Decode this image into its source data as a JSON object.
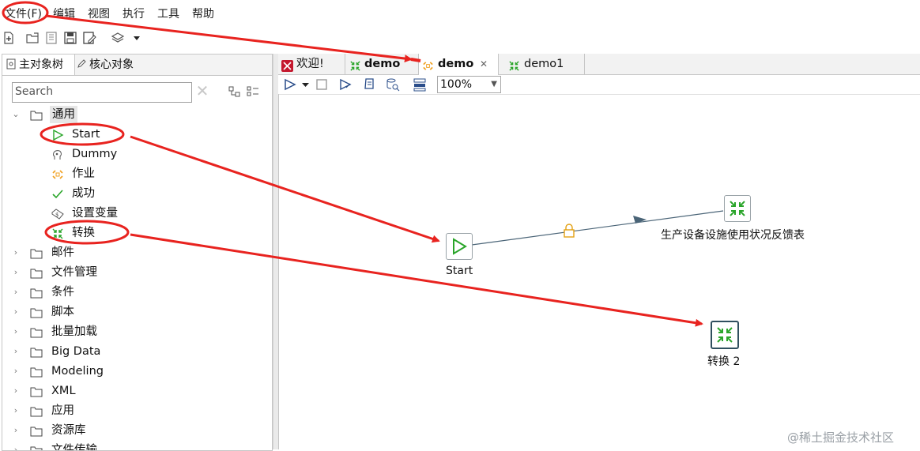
{
  "menubar": {
    "items": [
      "文件(F)",
      "编辑",
      "视图",
      "执行",
      "工具",
      "帮助"
    ]
  },
  "left_panel": {
    "tabs": [
      "主对象树",
      "核心对象"
    ],
    "search": {
      "placeholder": "Search",
      "value": ""
    },
    "tree": {
      "general_folder": "通用",
      "general_items": [
        "Start",
        "Dummy",
        "作业",
        "成功",
        "设置变量",
        "转换"
      ],
      "folders": [
        "邮件",
        "文件管理",
        "条件",
        "脚本",
        "批量加载",
        "Big Data",
        "Modeling",
        "XML",
        "应用",
        "资源库",
        "文件传输"
      ]
    }
  },
  "editor": {
    "tabs": [
      "欢迎!",
      "demo",
      "demo",
      "demo1"
    ],
    "zoom": "100%",
    "nodes": {
      "start_label": "Start",
      "trans1_label": "生产设备设施使用状况反馈表",
      "trans2_label": "转换 2"
    }
  },
  "annotation_color": "#e8231f",
  "watermark": "@稀土掘金技术社区"
}
